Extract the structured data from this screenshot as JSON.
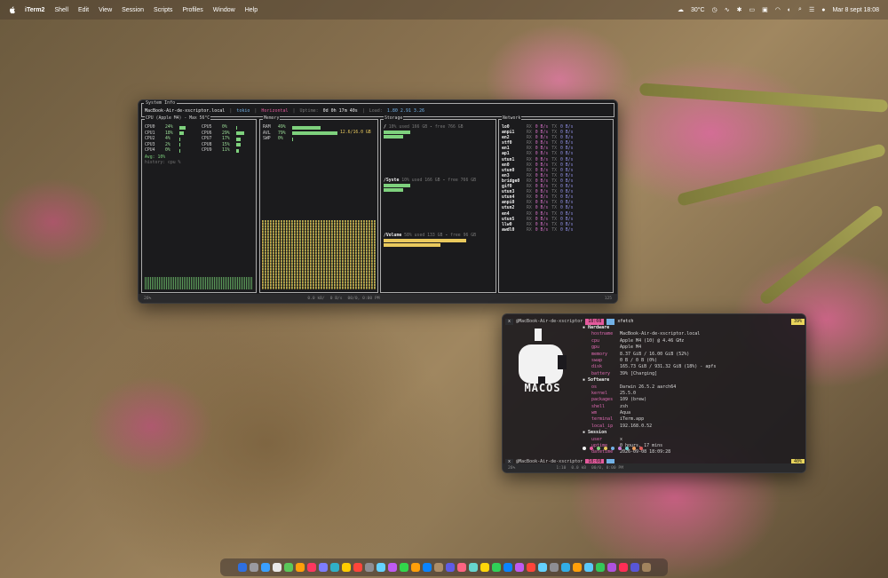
{
  "menubar": {
    "app": "iTerm2",
    "menus": [
      "Shell",
      "Edit",
      "View",
      "Session",
      "Scripts",
      "Profiles",
      "Window",
      "Help"
    ],
    "weather": "30°C",
    "datetime": "Mar 8 sept 18:08"
  },
  "btop": {
    "title": "System Info",
    "host": "MacBook-Air-de-xscriptor.local",
    "theme": "tokio",
    "layout": "Horizontal",
    "uptime_label": "Uptime:",
    "uptime": "0d 0h 17m 40s",
    "load_label": "Load:",
    "load": "1.80 2.91 3.26",
    "cpu": {
      "title": "CPU (Apple M4) - Max 56°C",
      "cores": [
        {
          "name": "CPU0",
          "pct": "24%",
          "level": 0.24
        },
        {
          "name": "CPU5",
          "pct": "0%",
          "level": 0.0
        },
        {
          "name": "CPU1",
          "pct": "18%",
          "level": 0.18
        },
        {
          "name": "CPU6",
          "pct": "29%",
          "level": 0.29
        },
        {
          "name": "CPU2",
          "pct": "4%",
          "level": 0.04
        },
        {
          "name": "CPU7",
          "pct": "17%",
          "level": 0.17
        },
        {
          "name": "CPU3",
          "pct": "2%",
          "level": 0.02
        },
        {
          "name": "CPU8",
          "pct": "15%",
          "level": 0.15
        },
        {
          "name": "CPU4",
          "pct": "0%",
          "level": 0.0
        },
        {
          "name": "CPU9",
          "pct": "11%",
          "level": 0.11
        }
      ],
      "avg": "Avg: 10%",
      "history": "history: cpu %"
    },
    "memory": {
      "title": "Memory",
      "rows": [
        {
          "name": "RAM",
          "pct": "49%",
          "level": 0.49
        },
        {
          "name": "AVL",
          "pct": "79%",
          "level": 0.79
        },
        {
          "name": "SWP",
          "pct": "0%",
          "level": 0.0
        }
      ],
      "total": "12.6/16.0 GB"
    },
    "storage": {
      "title": "Storage",
      "items": [
        {
          "mount": "/",
          "pct": "10%",
          "used": "used 166 GB",
          "free": "free 766 GB",
          "level": 0.1
        },
        {
          "mount": "/Syste",
          "pct": "10%",
          "used": "used 166 GB",
          "free": "free 766 GB",
          "level": 0.1
        },
        {
          "mount": "/Volume",
          "pct": "58%",
          "used": "used 133 GB",
          "free": "free 96 GB",
          "level": 0.58
        }
      ]
    },
    "network": {
      "title": "Network",
      "rx_label": "RX",
      "tx_label": "TX",
      "rate": "0 B/s",
      "interfaces": [
        "lo0",
        "anpi1",
        "en2",
        "stf0",
        "en1",
        "ap1",
        "utun1",
        "en0",
        "utun0",
        "en3",
        "bridge0",
        "gif0",
        "utun3",
        "utun4",
        "anpi0",
        "utun2",
        "en4",
        "utun5",
        "llw0",
        "awdl0"
      ]
    },
    "status": {
      "cpu": "26%",
      "net": "0.0 kB/",
      "net_rate": "0 B/s",
      "time": "00/0, 0:00 PM",
      "count": "125"
    }
  },
  "fetch": {
    "prompt": {
      "close": "x",
      "user": "@MacBook-Air-de-xscriptor",
      "time": "18:08",
      "cmd": "xfetch",
      "battery": "39%"
    },
    "logo_text": "MACOS",
    "sections": [
      {
        "title": "Hardware",
        "rows": [
          {
            "k": "hostname",
            "v": "MacBook-Air-de-xscriptor.local"
          },
          {
            "k": "cpu",
            "v": "Apple M4 (10) @ 4.46 GHz"
          },
          {
            "k": "gpu",
            "v": "Apple M4"
          },
          {
            "k": "memory",
            "v": "8.37 GiB / 16.00 GiB (52%)"
          },
          {
            "k": "swap",
            "v": "0 B / 0 B (0%)"
          },
          {
            "k": "disk",
            "v": "165.73 GiB / 931.32 GiB (18%) - apfs"
          },
          {
            "k": "battery",
            "v": "39% [Charging]"
          }
        ]
      },
      {
        "title": "Software",
        "rows": [
          {
            "k": "os",
            "v": "Darwin 26.5.2 aarch64"
          },
          {
            "k": "kernel",
            "v": "25.5.0"
          },
          {
            "k": "packages",
            "v": "109 (brew)"
          },
          {
            "k": "shell",
            "v": "zsh"
          },
          {
            "k": "wm",
            "v": "Aqua"
          },
          {
            "k": "terminal",
            "v": "iTerm.app"
          },
          {
            "k": "local_ip",
            "v": "192.168.0.52"
          }
        ]
      },
      {
        "title": "Session",
        "rows": [
          {
            "k": "user",
            "v": "x"
          },
          {
            "k": "uptime",
            "v": "0 hours, 17 mins"
          },
          {
            "k": "datetime",
            "v": "2026-09-08 18:09:28"
          }
        ]
      }
    ],
    "prompt2": {
      "close": "x",
      "user": "@MacBook-Air-de-xscriptor",
      "time": "18:08",
      "battery": "40%"
    },
    "status": {
      "cpu": "26%",
      "ratio": "1:10",
      "net": "0.0 kB",
      "time": "00/0, 0:00 PM"
    },
    "palette": [
      "#f2f2f2",
      "#e35a9c",
      "#7ed17d",
      "#e9c95d",
      "#72b1e6",
      "#c77dd9",
      "#6fd1d1",
      "#f0a060",
      "#e05a5a"
    ]
  },
  "colors": {
    "accent_pink": "#e35a9c",
    "accent_green": "#7ed17d",
    "accent_blue": "#72b1e6",
    "accent_yellow": "#e9c95d"
  }
}
